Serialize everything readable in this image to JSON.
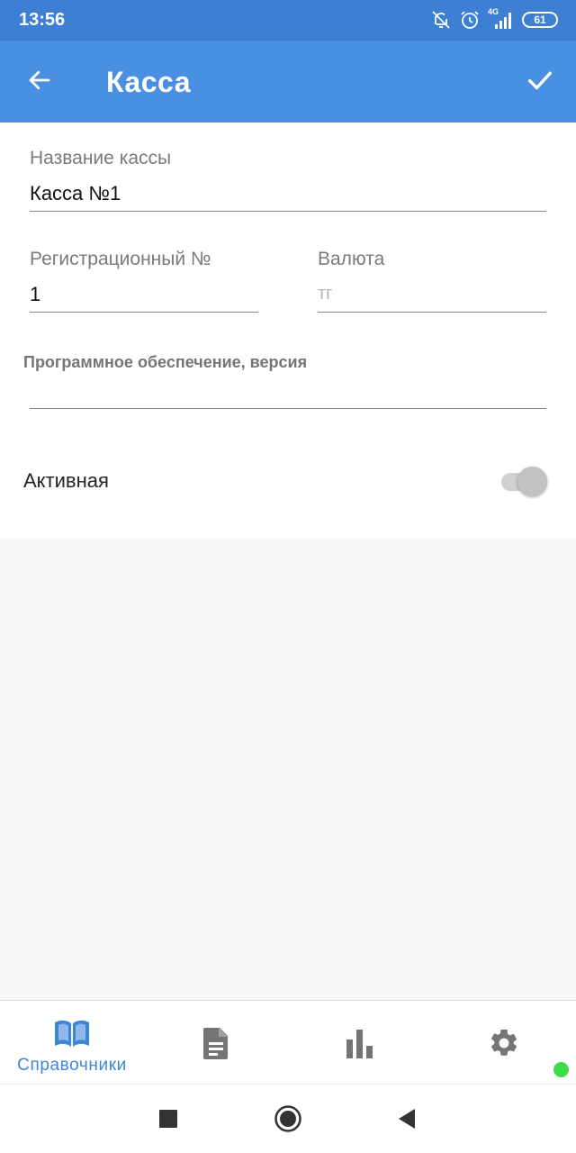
{
  "status_bar": {
    "time": "13:56",
    "network": "4G",
    "battery": "61",
    "icons": [
      "notifications-off-icon",
      "alarm-icon",
      "signal-icon",
      "battery-icon"
    ]
  },
  "app_bar": {
    "title": "Касса",
    "back_icon": "arrow-back-icon",
    "confirm_icon": "check-icon"
  },
  "form": {
    "name": {
      "label": "Название кассы",
      "value": "Касса №1"
    },
    "reg_number": {
      "label": "Регистрационный №",
      "value": "1"
    },
    "currency": {
      "label": "Валюта",
      "value": "",
      "placeholder": "тг"
    },
    "software": {
      "label": "Программное обеспечение, версия",
      "value": ""
    },
    "active": {
      "label": "Активная",
      "checked": false
    }
  },
  "bottom_nav": {
    "items": [
      {
        "label": "Справочники",
        "icon": "book-icon",
        "active": true
      },
      {
        "label": "",
        "icon": "document-icon",
        "active": false
      },
      {
        "label": "",
        "icon": "bar-chart-icon",
        "active": false
      },
      {
        "label": "",
        "icon": "settings-icon",
        "active": false
      }
    ]
  },
  "colors": {
    "app_bar": "#4a90e2",
    "status_bar": "#3d7fd3",
    "nav_active": "#3d86d8",
    "nav_inactive": "#757575",
    "online_indicator": "#3ddc4a"
  },
  "system_nav": [
    "recents-square-icon",
    "home-circle-icon",
    "back-triangle-icon"
  ]
}
